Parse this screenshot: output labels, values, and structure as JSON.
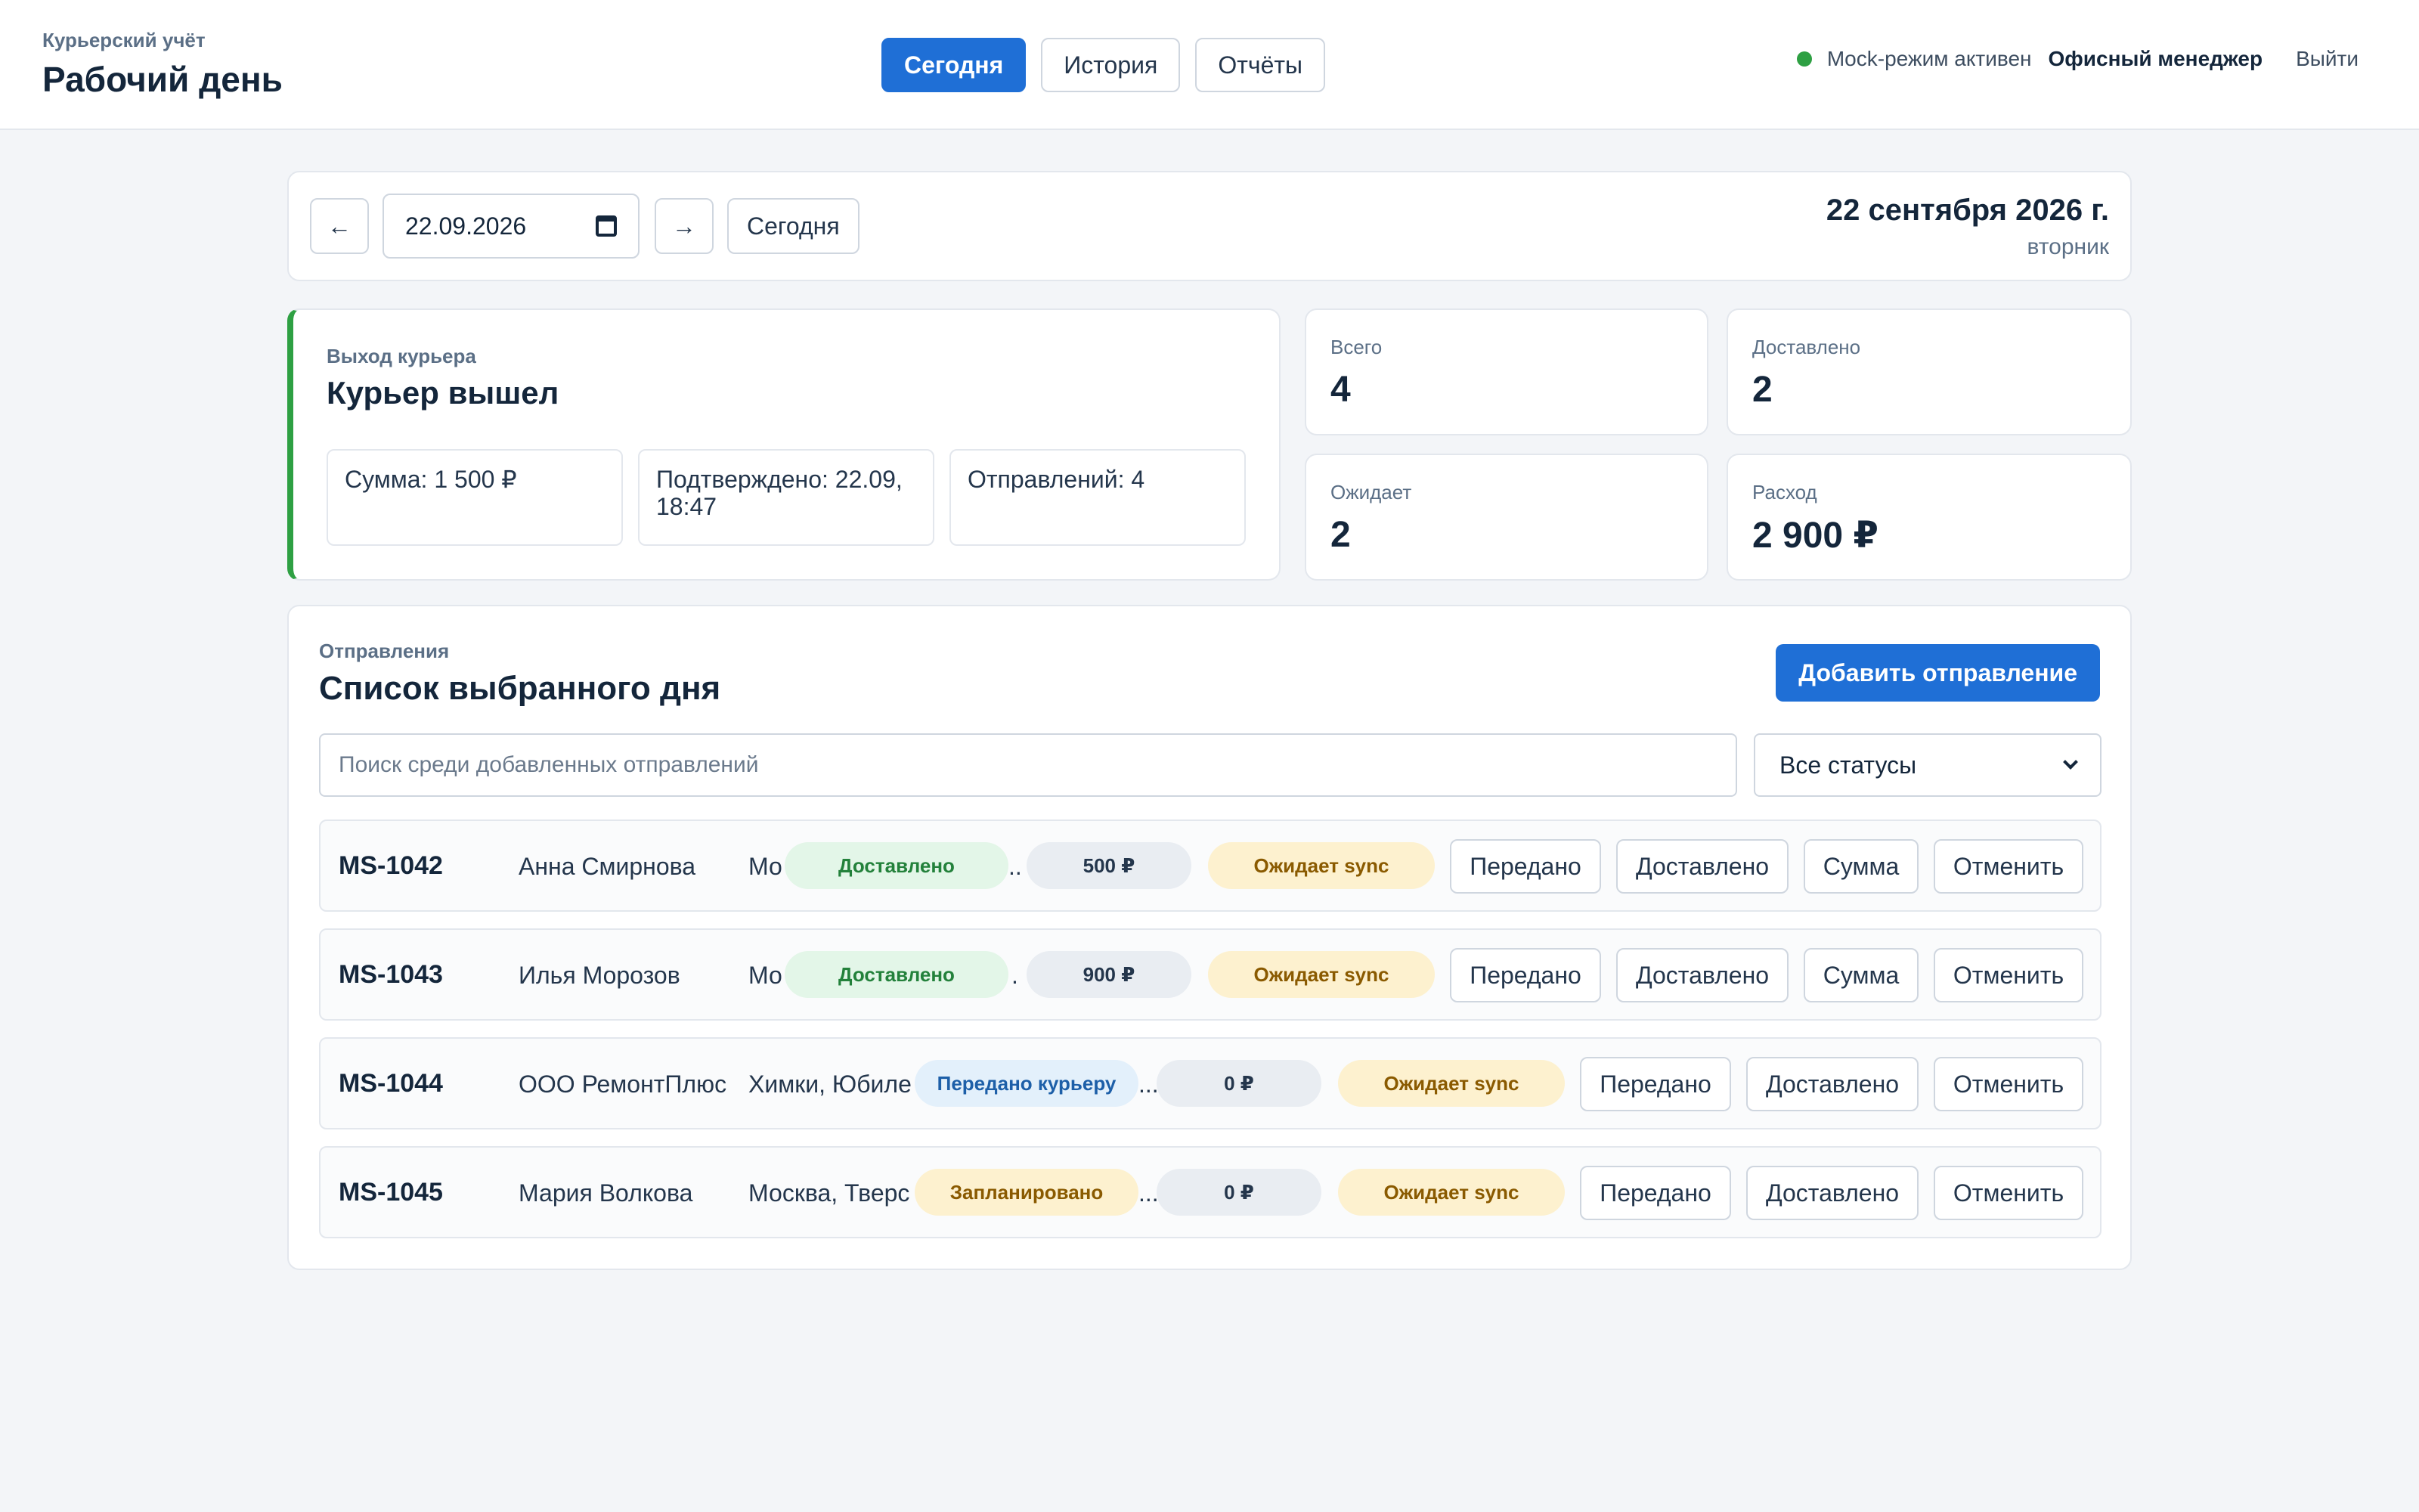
{
  "header": {
    "subtitle": "Курьерский учёт",
    "title": "Рабочий день",
    "nav": [
      {
        "label": "Сегодня",
        "active": true
      },
      {
        "label": "История",
        "active": false
      },
      {
        "label": "Отчёты",
        "active": false
      }
    ],
    "status_text": "Mock-режим активен",
    "status_color": "#2ea043",
    "user": "Офисный менеджер",
    "logout": "Выйти"
  },
  "date_bar": {
    "prev_icon": "arrow-left-icon",
    "prev_glyph": "←",
    "next_icon": "arrow-right-icon",
    "next_glyph": "→",
    "date_value": "22.09.2026",
    "today_label": "Сегодня",
    "date_long": "22 сентября 2026 г.",
    "weekday": "вторник"
  },
  "courier": {
    "subtitle": "Выход курьера",
    "title": "Курьер вышел",
    "accent": "#2ea043",
    "sum": "Сумма: 1 500 ₽",
    "confirmed": "Подтверждено: 22.09, 18:47",
    "shipments": "Отправлений: 4"
  },
  "stats": [
    {
      "label": "Всего",
      "value": "4"
    },
    {
      "label": "Доставлено",
      "value": "2"
    },
    {
      "label": "Ожидает",
      "value": "2"
    },
    {
      "label": "Расход",
      "value": "2 900 ₽"
    }
  ],
  "shipments": {
    "subtitle": "Отправления",
    "title": "Список выбранного дня",
    "add_label": "Добавить отправление",
    "search_placeholder": "Поиск среди добавленных отправлений",
    "status_filter": "Все статусы",
    "rows": [
      {
        "id": "MS-1042",
        "name": "Анна Смирнова",
        "addr": "Мо",
        "status": "Доставлено",
        "amount": "500 ₽",
        "sync": "Ожидает sync",
        "actions": [
          "Передано",
          "Доставлено",
          "Сумма",
          "Отменить"
        ],
        "ellipsis": ".."
      },
      {
        "id": "MS-1043",
        "name": "Илья Морозов",
        "addr": "Мо",
        "status": "Доставлено",
        "amount": "900 ₽",
        "sync": "Ожидает sync",
        "actions": [
          "Передано",
          "Доставлено",
          "Сумма",
          "Отменить"
        ],
        "ellipsis": "."
      },
      {
        "id": "MS-1044",
        "name": "ООО РемонтПлюс",
        "addr": "Химки, Юбиле",
        "status": "Передано курьеру",
        "amount": "0 ₽",
        "sync": "Ожидает sync",
        "actions": [
          "Передано",
          "Доставлено",
          "Отменить"
        ],
        "ellipsis": "..."
      },
      {
        "id": "MS-1045",
        "name": "Мария Волкова",
        "addr": "Москва, Тверс",
        "status": "Запланировано",
        "amount": "0 ₽",
        "sync": "Ожидает sync",
        "actions": [
          "Передано",
          "Доставлено",
          "Отменить"
        ],
        "ellipsis": "..."
      }
    ]
  }
}
